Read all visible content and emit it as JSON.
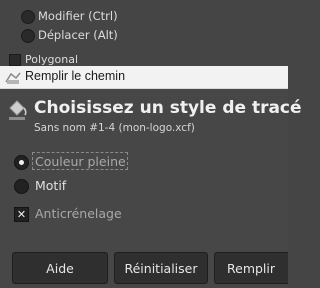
{
  "background_panel": {
    "items": [
      {
        "label": "Modifier (Ctrl)"
      },
      {
        "label": "Déplacer (Alt)"
      }
    ],
    "polygonal_label": "Polygonal"
  },
  "dialog": {
    "window_title": "Remplir le chemin",
    "heading": "Choisissez un style de tracé",
    "subheading": "Sans nom #1-4 (mon-logo.xcf)",
    "options": {
      "solid_color_label": "Couleur pleine",
      "pattern_label": "Motif",
      "antialiasing_label": "Anticrénelage"
    },
    "buttons": {
      "help": "Aide",
      "reset": "Réinitialiser",
      "fill": "Remplir"
    }
  },
  "colors": {
    "panel_bg": "#454545",
    "titlebar_bg": "#f2f2f2",
    "button_bg": "#2f2f2f"
  }
}
